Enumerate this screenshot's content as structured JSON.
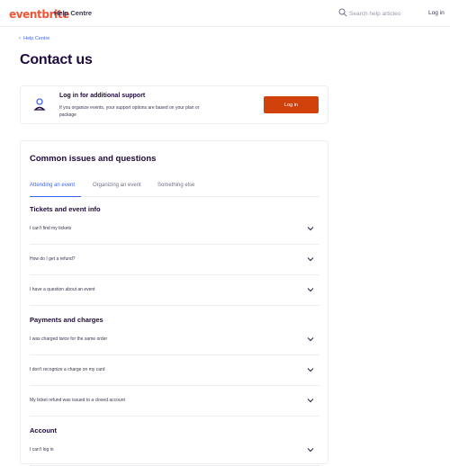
{
  "header": {
    "logo_text": "eventbrite",
    "section_label": "Help Centre",
    "search_placeholder": "Search help articles",
    "login_label": "Log in"
  },
  "breadcrumb": {
    "label": "Help Centre"
  },
  "page": {
    "title": "Contact us"
  },
  "login_card": {
    "title": "Log in for additional support",
    "description": "If you organize events, your support options are based on your plan or package",
    "button_label": "Log in"
  },
  "issues": {
    "title": "Common issues and questions",
    "tabs": [
      {
        "label": "Attending an event",
        "active": true
      },
      {
        "label": "Organizing an event",
        "active": false
      },
      {
        "label": "Something else",
        "active": false
      }
    ],
    "sections": [
      {
        "heading": "Tickets and event info",
        "items": [
          "I can't find my tickets",
          "How do I get a refund?",
          "I have a question about an event"
        ]
      },
      {
        "heading": "Payments and charges",
        "items": [
          "I was charged twice for the same order",
          "I don't recognize a charge on my card",
          "My ticket refund was issued to a closed account"
        ]
      },
      {
        "heading": "Account",
        "items": [
          "I can't log in"
        ]
      }
    ]
  },
  "colors": {
    "brand": "#f05537",
    "primary_button": "#d1410c",
    "link": "#3d64ff",
    "text_dark": "#1e0a3c"
  }
}
